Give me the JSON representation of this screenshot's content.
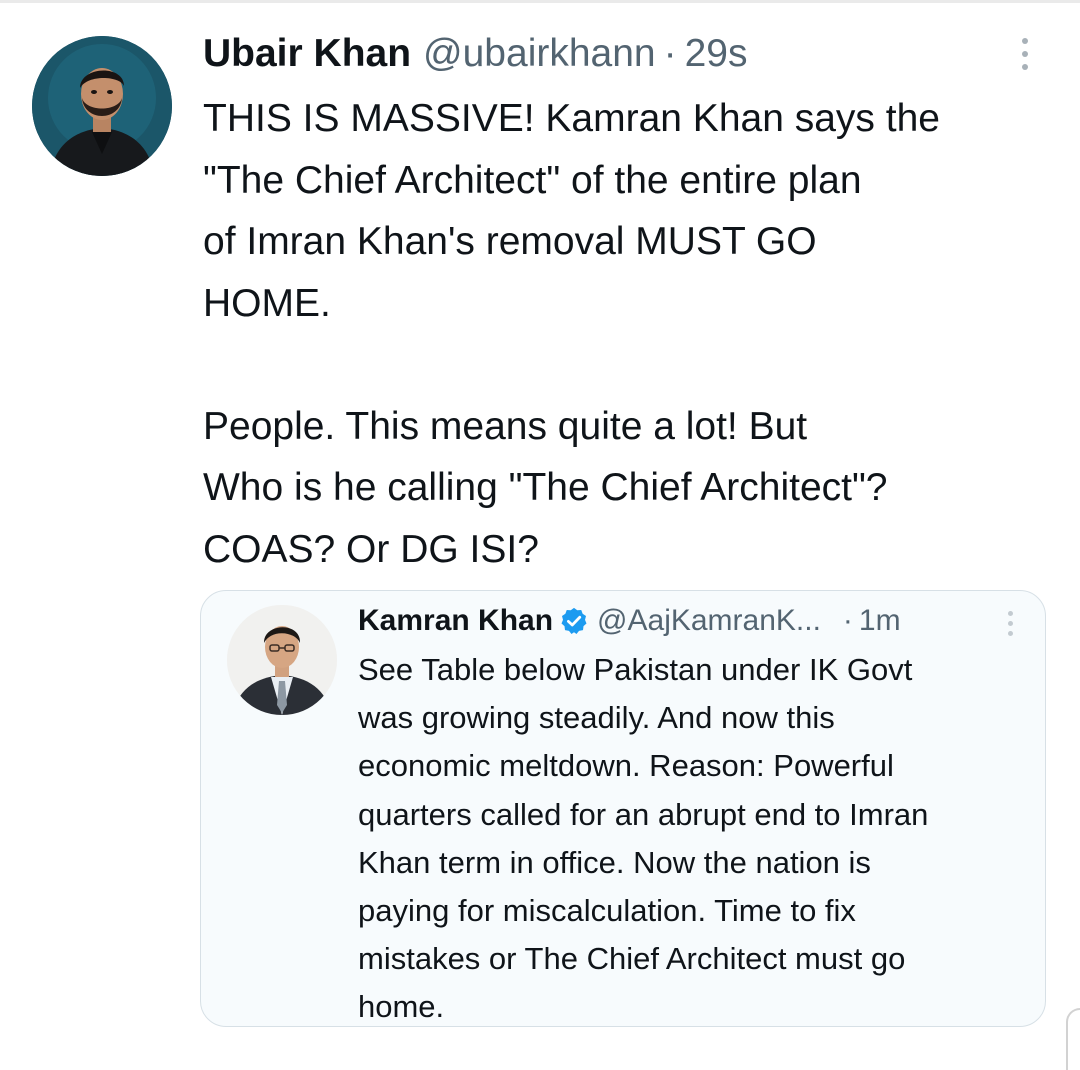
{
  "tweet": {
    "author_name": "Ubair Khan",
    "author_handle": "@ubairkhann",
    "separator": "·",
    "time": "29s",
    "more_icon": "more-vertical-icon",
    "body_lines_1": [
      "THIS IS MASSIVE! Kamran Khan says the",
      "\"The Chief Architect\" of the entire plan",
      "of Imran Khan's removal MUST GO",
      "HOME."
    ],
    "body_lines_2": [
      "People. This means quite a lot! But",
      "Who is he calling \"The Chief Architect\"?",
      "COAS? Or DG ISI?"
    ]
  },
  "quoted_tweet": {
    "author_name": "Kamran Khan",
    "verified_icon": "verified-badge-icon",
    "author_handle": "@AajKamranK...",
    "separator": "·",
    "time": "1m",
    "body_lines": [
      "See Table below Pakistan under IK Govt",
      "was growing steadily. And now this",
      "economic meltdown. Reason: Powerful",
      "quarters called for an abrupt end to Imran",
      "Khan term in office. Now the nation is",
      "paying for miscalculation. Time to fix",
      "mistakes or The Chief Architect must go",
      "home."
    ]
  },
  "colors": {
    "text_primary": "#0f1419",
    "text_secondary": "#536471",
    "verified_blue": "#1d9bf0",
    "quote_border": "#d7e0e6",
    "quote_background": "#f7fbfd"
  }
}
